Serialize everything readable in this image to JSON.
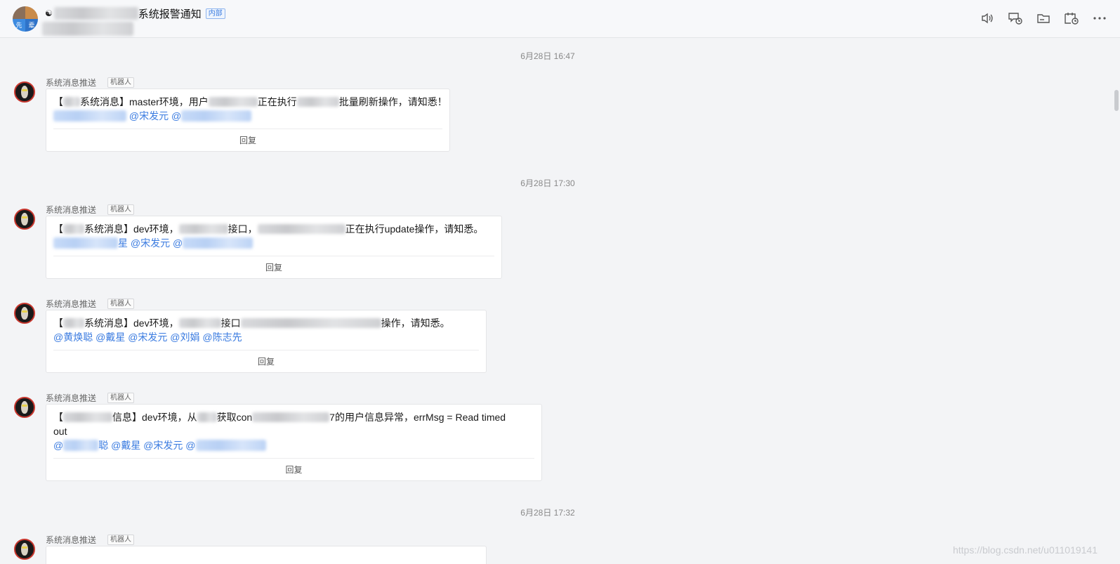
{
  "header": {
    "group_avatar_chars": [
      "",
      "",
      "先",
      "辈"
    ],
    "title_emoji": "☯",
    "title": "系统报警通知",
    "internal_tag": "内部",
    "tools": [
      "speaker-icon",
      "chat-history-icon",
      "folder-icon",
      "calendar-clock-icon",
      "more-icon"
    ]
  },
  "messages": [
    {
      "timestamp": "6月28日 16:47",
      "sender": "系统消息推送",
      "bot_tag": "机器人",
      "text_parts": [
        "【",
        "系统消息】master环境，用户",
        "正在执行",
        "批量刷新操作，请知悉！"
      ],
      "mentions": [
        "@宋发元 @"
      ],
      "reply": "回复"
    },
    {
      "timestamp": "6月28日 17:30",
      "sender": "系统消息推送",
      "bot_tag": "机器人",
      "text_parts": [
        "【",
        "系统消息】dev环境，",
        "接口，",
        "正在执行update操作，请知悉。"
      ],
      "mentions": [
        "星 @宋发元 @"
      ],
      "reply": "回复"
    },
    {
      "sender": "系统消息推送",
      "bot_tag": "机器人",
      "text_parts": [
        "【",
        "系统消息】dev环境，",
        "接口",
        "操作，请知悉。"
      ],
      "mentions": [
        "@黄焕聪 @戴星 @宋发元 @刘娟 @陈志先"
      ],
      "reply": "回复"
    },
    {
      "sender": "系统消息推送",
      "bot_tag": "机器人",
      "text_parts": [
        "【",
        "信息】dev环境，从",
        "获取con",
        "7的用户信息异常，errMsg = Read timed",
        "out"
      ],
      "mentions": [
        "@",
        "聪 @戴星 @宋发元 @"
      ],
      "reply": "回复"
    },
    {
      "timestamp": "6月28日 17:32",
      "sender": "系统消息推送",
      "bot_tag": "机器人"
    }
  ],
  "watermark": "https://blog.csdn.net/u011019141"
}
